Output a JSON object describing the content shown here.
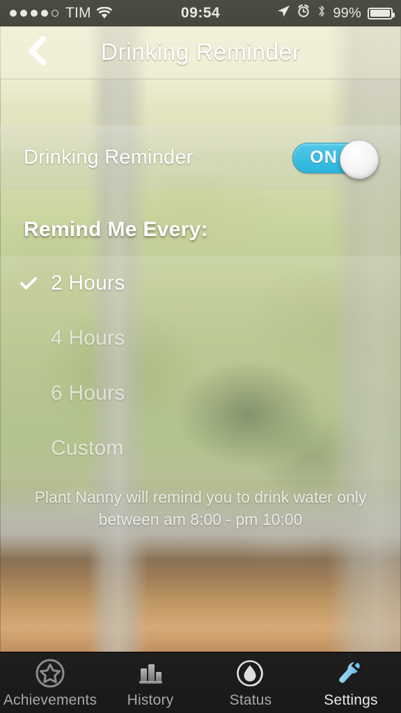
{
  "status_bar": {
    "carrier": "TIM",
    "signal_dots_filled": 4,
    "signal_dots_total": 5,
    "wifi_icon": "wifi-icon",
    "time": "09:54",
    "location_icon": "location-arrow-icon",
    "alarm_icon": "alarm-clock-icon",
    "bluetooth_icon": "bluetooth-icon",
    "battery_percent": "99%",
    "battery_icon": "battery-full-icon"
  },
  "navbar": {
    "back_icon": "chevron-left-icon",
    "title": "Drinking Reminder"
  },
  "toggle_row": {
    "label": "Drinking Reminder",
    "switch_state": "ON",
    "switch_on_color": "#2cb4dc",
    "switch_knob_color": "#f4f4f4"
  },
  "section": {
    "title": "Remind Me Every:",
    "selected_index": 0,
    "check_icon": "checkmark-icon",
    "options": [
      {
        "label": "2 Hours",
        "selected": true
      },
      {
        "label": "4 Hours",
        "selected": false
      },
      {
        "label": "6 Hours",
        "selected": false
      },
      {
        "label": "Custom",
        "selected": false
      }
    ]
  },
  "footnote": {
    "line1": "Plant Nanny will remind you to drink water only",
    "line2": "between am 8:00 - pm 10:00"
  },
  "tabbar": {
    "active_color": "#7ec8ec",
    "inactive_color": "#8c8c8c",
    "tabs": [
      {
        "label": "Achievements",
        "icon": "star-in-circle-icon",
        "active": false
      },
      {
        "label": "History",
        "icon": "bar-chart-icon",
        "active": false
      },
      {
        "label": "Status",
        "icon": "water-drop-icon",
        "active": false
      },
      {
        "label": "Settings",
        "icon": "wrench-icon",
        "active": true
      }
    ]
  }
}
